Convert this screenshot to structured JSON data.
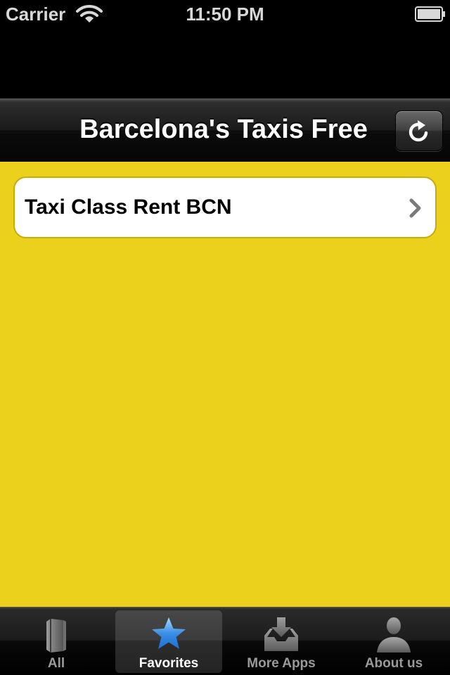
{
  "status_bar": {
    "carrier": "Carrier",
    "time": "11:50 PM"
  },
  "nav_bar": {
    "title": "Barcelona's Taxis Free",
    "right_button_icon": "refresh-icon"
  },
  "list": {
    "items": [
      {
        "label": "Taxi Class Rent BCN",
        "accessory_icon": "chevron-right-icon"
      }
    ]
  },
  "tab_bar": {
    "selected": "Favorites",
    "tabs": [
      {
        "label": "All",
        "icon": "book-icon"
      },
      {
        "label": "Favorites",
        "icon": "star-icon"
      },
      {
        "label": "More Apps",
        "icon": "download-tray-icon"
      },
      {
        "label": "About us",
        "icon": "person-icon"
      }
    ]
  },
  "colors": {
    "content_background": "#ecd11c",
    "tab_selected_star": "#3a8fe6"
  }
}
